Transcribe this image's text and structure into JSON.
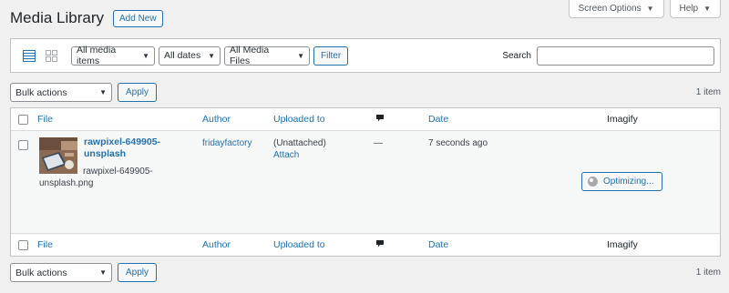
{
  "screen_meta": {
    "screen_options": "Screen Options",
    "help": "Help"
  },
  "header": {
    "title": "Media Library",
    "add_new": "Add New"
  },
  "filters": {
    "media_type": "All media items",
    "dates": "All dates",
    "files": "All Media Files",
    "filter_btn": "Filter",
    "search_label": "Search",
    "search_value": ""
  },
  "bulk": {
    "label": "Bulk actions",
    "apply": "Apply",
    "count": "1 item"
  },
  "columns": {
    "file": "File",
    "author": "Author",
    "uploaded_to": "Uploaded to",
    "date": "Date",
    "imagify": "Imagify"
  },
  "rows": [
    {
      "title": "rawpixel-649905-unsplash",
      "filename": "rawpixel-649905-unsplash.png",
      "author": "fridayfactory",
      "uploaded_to": "(Unattached)",
      "attach": "Attach",
      "comments": "—",
      "date": "7 seconds ago",
      "imagify_status": "Optimizing..."
    }
  ],
  "colors": {
    "accent": "#2271b1",
    "bg": "#f0f0f1",
    "border": "#c3c4c7"
  }
}
